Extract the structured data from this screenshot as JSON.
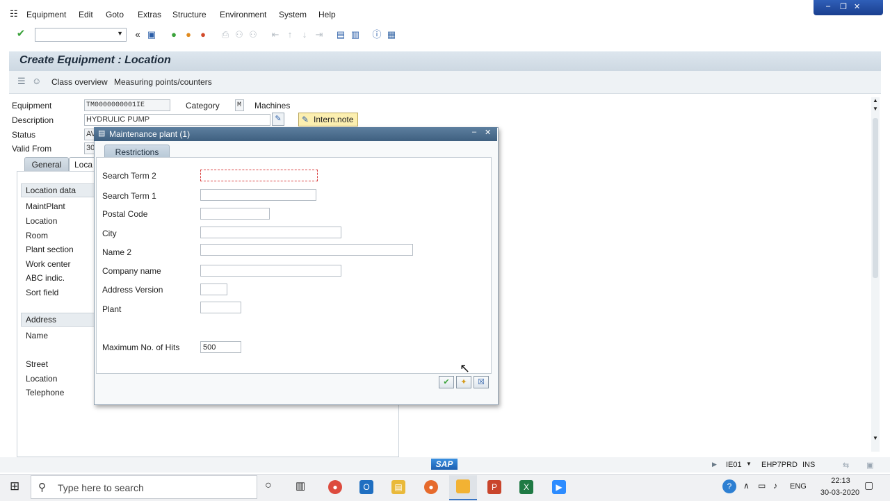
{
  "menu": {
    "items": [
      "Equipment",
      "Edit",
      "Goto",
      "Extras",
      "Structure",
      "Environment",
      "System",
      "Help"
    ]
  },
  "page": {
    "title": "Create Equipment : Location",
    "app_toolbar": {
      "class_overview": "Class overview",
      "measuring_points": "Measuring points/counters"
    }
  },
  "header_form": {
    "equipment_label": "Equipment",
    "equipment_value": "TM0000000001IE",
    "category_label": "Category",
    "category_value": "M",
    "category_text": "Machines",
    "description_label": "Description",
    "description_value": "HYDRULIC PUMP",
    "status_label": "Status",
    "status_value": "AV",
    "valid_from_label": "Valid From",
    "valid_from_value": "30",
    "intern_note": "Intern.note"
  },
  "tabs": {
    "general": "General",
    "location": "Loca"
  },
  "location_group": {
    "header": "Location data",
    "fields": [
      "MaintPlant",
      "Location",
      "Room",
      "Plant section",
      "Work center",
      "ABC indic.",
      "Sort field"
    ]
  },
  "address_group": {
    "header": "Address",
    "fields": [
      "Name",
      "Street",
      "Location",
      "Telephone"
    ]
  },
  "dialog": {
    "title": "Maintenance plant (1)",
    "tab": "Restrictions",
    "labels": {
      "search_term_2": "Search Term 2",
      "search_term_1": "Search Term 1",
      "postal_code": "Postal Code",
      "city": "City",
      "name_2": "Name 2",
      "company_name": "Company name",
      "address_version": "Address Version",
      "plant": "Plant",
      "max_hits": "Maximum No. of Hits"
    },
    "max_hits_value": "500"
  },
  "statusbar": {
    "logo": "SAP",
    "transaction": "IE01",
    "system": "EHP7PRD",
    "mode": "INS"
  },
  "taskbar": {
    "search_placeholder": "Type here to search",
    "time": "22:13",
    "date": "30-03-2020",
    "lang": "ENG"
  },
  "colors": {
    "dialog_title": "#3f6080",
    "accent_green": "#3aa23a",
    "title_bar": "#cdd8e2"
  }
}
